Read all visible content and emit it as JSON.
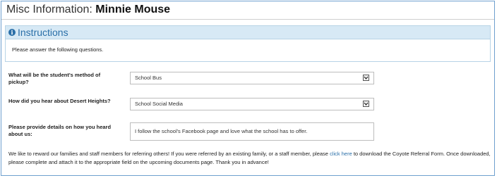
{
  "header": {
    "title_prefix": "Misc Information: ",
    "student_name": "Minnie Mouse"
  },
  "instructions": {
    "heading": "Instructions",
    "icon": "info-circle-icon",
    "text": "Please answer the following questions."
  },
  "questions": [
    {
      "label": "What will be the student's method of pickup?",
      "type": "select",
      "value": "School Bus"
    },
    {
      "label": "How did you hear about Desert Heights?",
      "type": "select",
      "value": "School Social Media"
    },
    {
      "label": "Please provide details on how you heard about us:",
      "type": "text",
      "value": "I follow the school's Facebook page and love what the school has to offer."
    }
  ],
  "referral": {
    "text_before": "We like to reward our families and staff members for referring others! If you were referred by an existing family, or a staff member, please ",
    "link": "click here",
    "text_after": " to download the Coyote Referral Form. Once downloaded, please complete and attach it to the appropriate field on the upcoming documents page. Thank you in advance!"
  },
  "colors": {
    "border": "#6fa0cf",
    "instructions_bg": "#d7e9f5",
    "accent": "#2a6fa8"
  }
}
